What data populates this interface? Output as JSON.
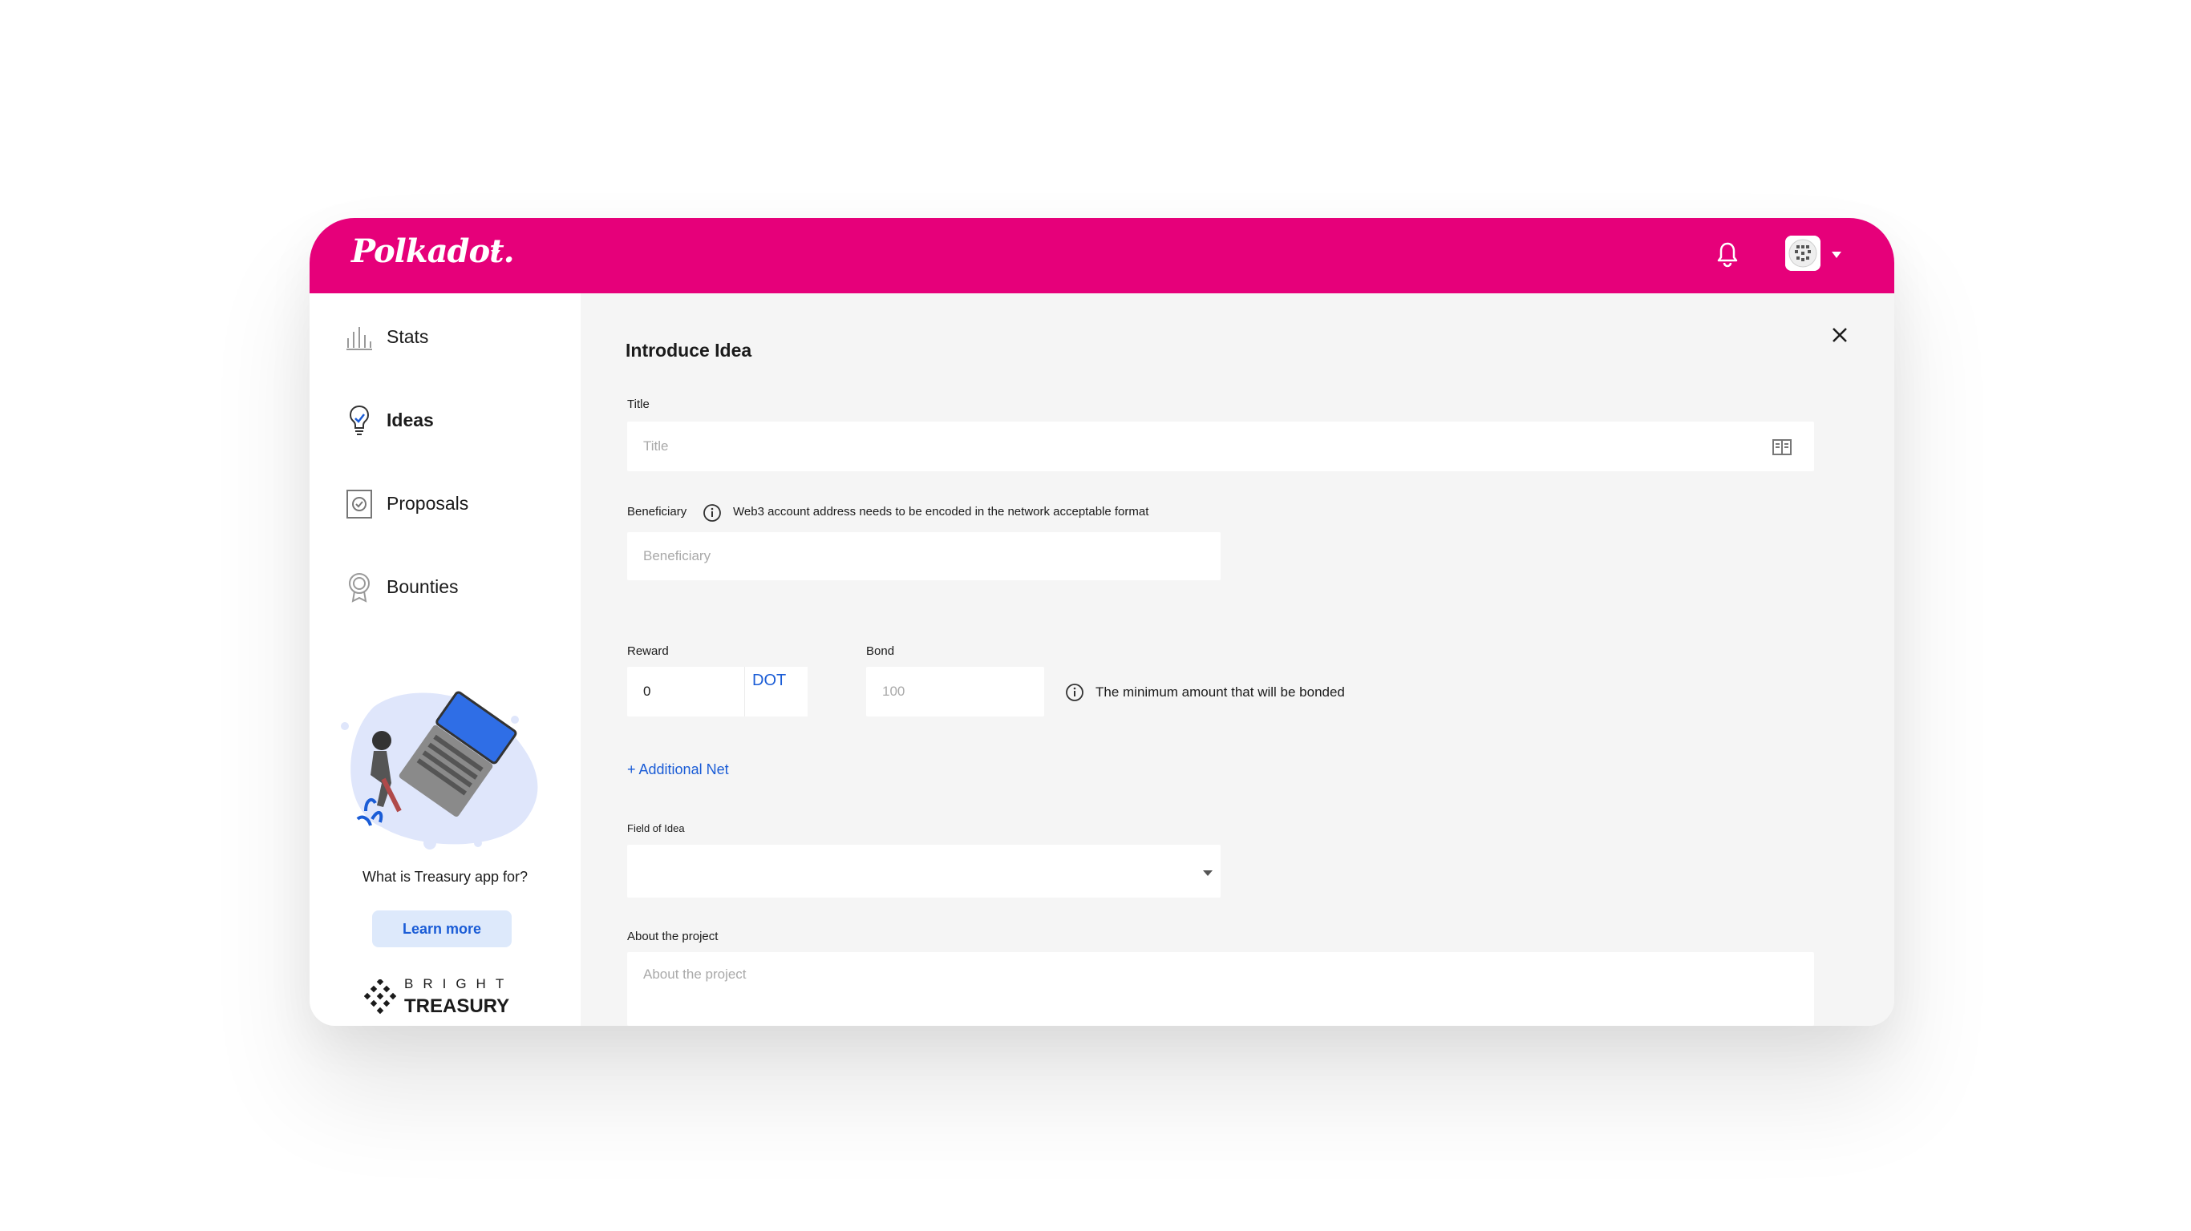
{
  "header": {
    "logo_text": "Polkadot.",
    "brand_color": "#e6007a",
    "network_dropdown_icon": "caret-down-icon",
    "notification_icon": "bell-icon",
    "avatar_icon": "identicon-avatar"
  },
  "sidebar": {
    "items": [
      {
        "label": "Stats",
        "icon": "bar-chart-icon",
        "active": false
      },
      {
        "label": "Ideas",
        "icon": "lightbulb-icon",
        "active": true
      },
      {
        "label": "Proposals",
        "icon": "checklist-icon",
        "active": false
      },
      {
        "label": "Bounties",
        "icon": "badge-icon",
        "active": false
      }
    ],
    "promo": {
      "text": "What is Treasury app for?",
      "button_label": "Learn more"
    },
    "brand": {
      "top": "BRIGHT",
      "bottom": "TREASURY"
    }
  },
  "form": {
    "heading": "Introduce Idea",
    "title_label": "Title",
    "title_placeholder": "Title",
    "beneficiary_label": "Beneficiary",
    "beneficiary_hint": "Web3 account address needs to be encoded in the network acceptable format",
    "beneficiary_placeholder": "Beneficiary",
    "reward_label": "Reward",
    "reward_value": "0",
    "reward_unit": "DOT",
    "bond_label": "Bond",
    "bond_placeholder": "100",
    "bond_hint": "The minimum amount that will be bonded",
    "add_net_label": "+ Additional Net",
    "field_label": "Field of Idea",
    "field_value": "",
    "about_label": "About the project",
    "about_placeholder": "About the project"
  },
  "colors": {
    "accent": "#1a5cd6",
    "background": "#f5f5f5",
    "sidebar": "#ffffff"
  }
}
